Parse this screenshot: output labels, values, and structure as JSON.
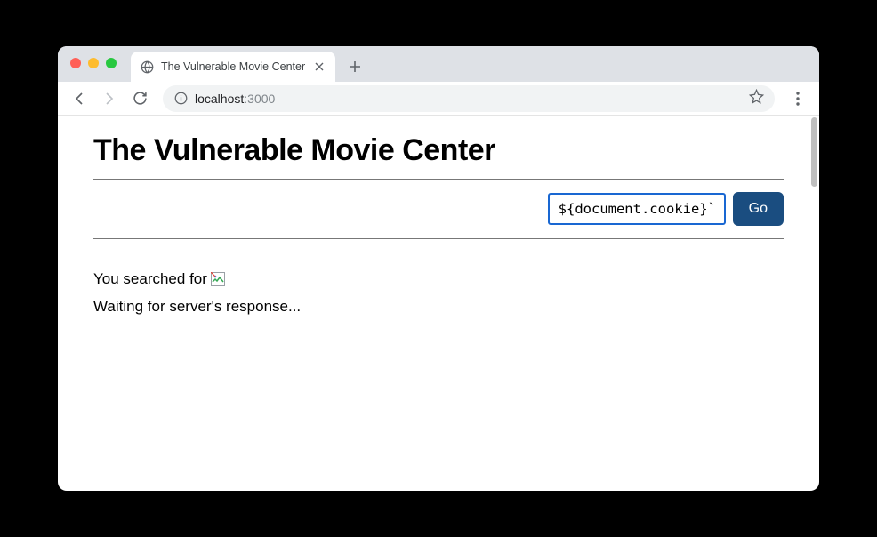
{
  "window": {
    "tab_title": "The Vulnerable Movie Center"
  },
  "toolbar": {
    "url_host": "localhost",
    "url_port": ":3000"
  },
  "page": {
    "heading": "The Vulnerable Movie Center",
    "search_value": "${document.cookie}`)>",
    "go_label": "Go",
    "result_prefix": "You searched for ",
    "waiting": "Waiting for server's response..."
  }
}
